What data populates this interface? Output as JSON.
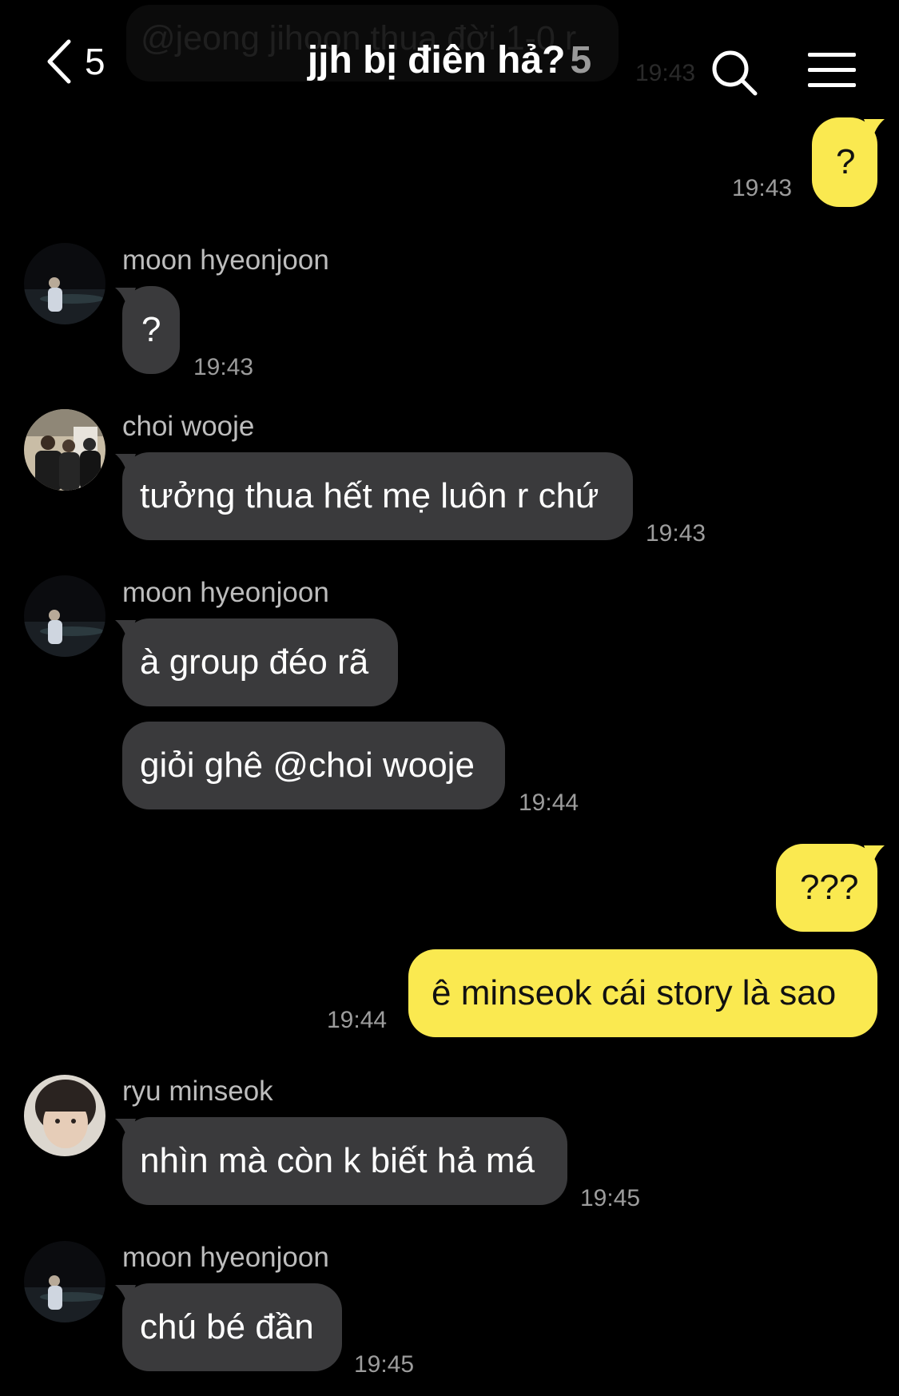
{
  "header": {
    "back_count": "5",
    "title": "jjh bị điên hả?",
    "member_count": "5",
    "behind_message": "@jeong jihoon thua đời 1-0 r",
    "behind_time": "19:43"
  },
  "messages": [
    {
      "sender": "",
      "text": "?",
      "time": "19:43"
    },
    {
      "sender": "moon hyeonjoon",
      "text": "?",
      "time": "19:43"
    },
    {
      "sender": "choi wooje",
      "text": "tưởng thua hết mẹ luôn r chứ",
      "time": "19:43"
    },
    {
      "sender": "moon hyeonjoon",
      "text": "à group đéo rã",
      "time": ""
    },
    {
      "sender": "",
      "text": "giỏi ghê @choi wooje",
      "time": "19:44"
    },
    {
      "sender": "",
      "text": "???",
      "time": ""
    },
    {
      "sender": "",
      "text": "ê minseok cái story là sao",
      "time": "19:44"
    },
    {
      "sender": "ryu minseok",
      "text": "nhìn mà còn k biết hả má",
      "time": "19:45"
    },
    {
      "sender": "moon hyeonjoon",
      "text": "chú bé đần",
      "time": "19:45"
    }
  ],
  "colors": {
    "background": "#000000",
    "incoming_bubble": "#3a3a3c",
    "outgoing_bubble": "#fae950",
    "timestamp": "#9c9c9c",
    "sender_name": "#bdbdbd"
  },
  "icons": [
    "chevron-left-icon",
    "search-icon",
    "menu-icon",
    "avatar-photo"
  ]
}
